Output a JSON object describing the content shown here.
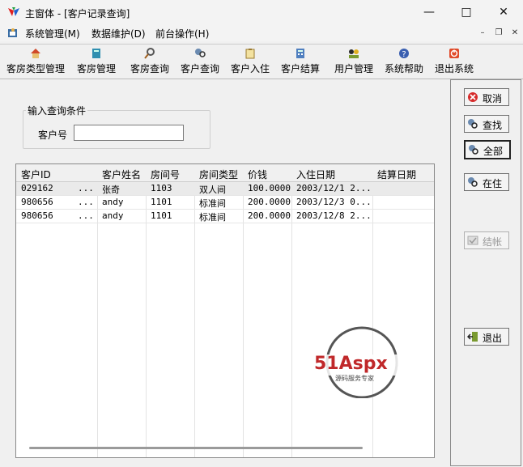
{
  "window": {
    "title": "主窗体 - [客户记录查询]"
  },
  "menu": {
    "items": [
      "系统管理(M)",
      "数据维护(D)",
      "前台操作(H)"
    ]
  },
  "toolbar": {
    "items": [
      "客房类型管理",
      "客房管理",
      "客房查询",
      "客户查询",
      "客户入住",
      "客户结算",
      "用户管理",
      "系统帮助",
      "退出系统"
    ]
  },
  "query": {
    "group_title": "输入查询条件",
    "label": "客户号",
    "value": ""
  },
  "grid": {
    "columns": [
      "客户ID",
      "客户姓名",
      "房间号",
      "房间类型",
      "价钱",
      "入住日期",
      "结算日期"
    ],
    "rows": [
      [
        "029162",
        "...",
        "张奇",
        "1103",
        "双人间",
        "100.0000",
        "2003/12/1 2...",
        ""
      ],
      [
        "980656",
        "...",
        "andy",
        "1101",
        "标准间",
        "200.0000",
        "2003/12/3 0...",
        ""
      ],
      [
        "980656",
        "...",
        "andy",
        "1101",
        "标准间",
        "200.0000",
        "2003/12/8 2...",
        ""
      ]
    ]
  },
  "side": {
    "cancel": "取消",
    "find": "查找",
    "all": "全部",
    "staying": "在住",
    "settle": "结帐",
    "exit": "退出"
  },
  "watermark": {
    "brand": "51Aspx",
    "tagline": "源码服务专家"
  }
}
